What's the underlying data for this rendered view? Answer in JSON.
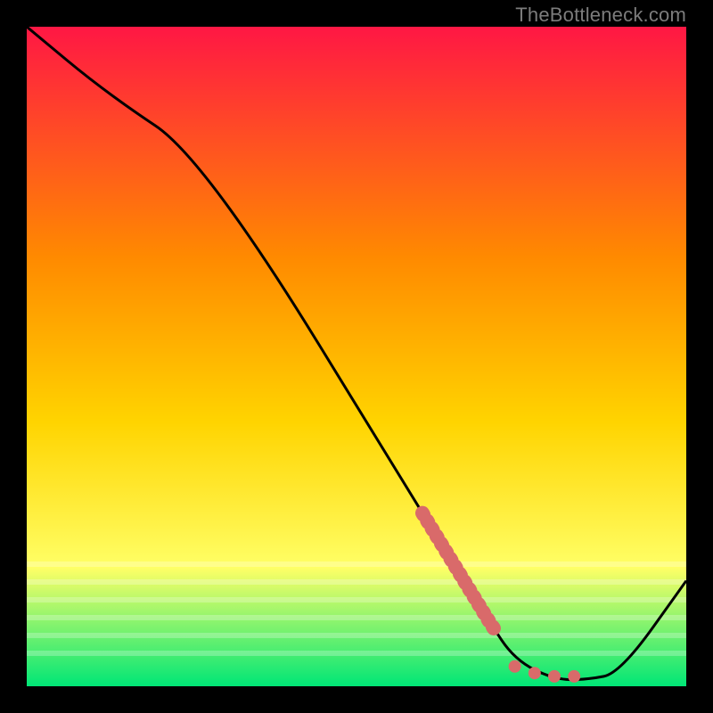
{
  "attribution": "TheBottleneck.com",
  "colors": {
    "frame": "#000000",
    "gradient_top": "#ff1744",
    "gradient_mid1": "#ff8a00",
    "gradient_mid2": "#ffd400",
    "gradient_mid3": "#ffff66",
    "gradient_bottom": "#00e676",
    "curve": "#000000",
    "marker": "#d96a6a"
  },
  "chart_data": {
    "type": "line",
    "title": "",
    "xlabel": "",
    "ylabel": "",
    "xlim": [
      0,
      100
    ],
    "ylim": [
      0,
      100
    ],
    "series": [
      {
        "name": "bottleneck-curve",
        "x": [
          0,
          12,
          27,
          62,
          70,
          74,
          80,
          85,
          90,
          100
        ],
        "y": [
          100,
          90,
          80,
          23,
          10,
          4,
          1,
          1,
          2,
          16
        ]
      }
    ],
    "markers": [
      {
        "name": "highlight-segment",
        "x_start": 60,
        "x_end": 71,
        "description": "thick dashed coral stroke along curve"
      },
      {
        "name": "dot-cluster",
        "points": [
          {
            "x": 74,
            "y": 3
          },
          {
            "x": 77,
            "y": 2
          },
          {
            "x": 80,
            "y": 1.5
          },
          {
            "x": 83,
            "y": 1.5
          }
        ]
      }
    ]
  }
}
